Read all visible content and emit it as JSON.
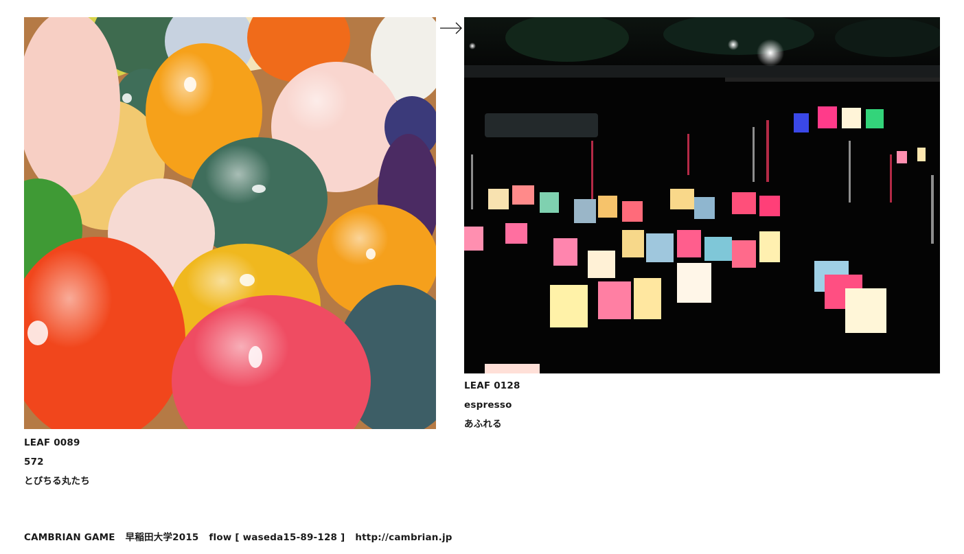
{
  "leaves": [
    {
      "id": "LEAF 0089",
      "author": "572",
      "title": "とびちる丸たち"
    },
    {
      "id": "LEAF 0128",
      "author": "espresso",
      "title": "あふれる"
    }
  ],
  "arrow_icon": "arrow-right-icon",
  "footer": {
    "project": "CAMBRIAN GAME",
    "venue": "早稲田大学2015",
    "flow": "flow [ waseda15-89-128 ]",
    "url": "http://cambrian.jp"
  }
}
